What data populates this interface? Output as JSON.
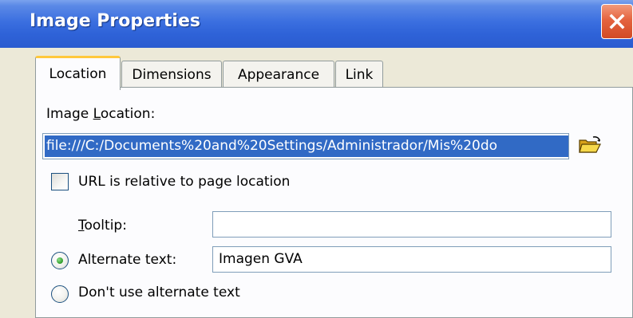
{
  "window": {
    "title": "Image Properties",
    "close_icon": "close-icon"
  },
  "tabs": [
    {
      "label": "Location",
      "active": true
    },
    {
      "label": "Dimensions",
      "active": false
    },
    {
      "label": "Appearance",
      "active": false
    },
    {
      "label": "Link",
      "active": false
    }
  ],
  "location": {
    "image_location_label_prefix": "Image ",
    "image_location_label_accel": "L",
    "image_location_label_suffix": "ocation:",
    "image_location_value": "file:///C:/Documents%20and%20Settings/Administrador/Mis%20do",
    "choose_file_icon": "open-folder-icon",
    "relative_url": {
      "label": "URL is relative to page location",
      "checked": false
    },
    "tooltip": {
      "label_accel": "T",
      "label_rest": "ooltip:",
      "value": ""
    },
    "alt_text": {
      "label": "Alternate text:",
      "selected": true,
      "value": "Imagen GVA"
    },
    "no_alt_text": {
      "label": "Don't use alternate text",
      "selected": false
    }
  },
  "colors": {
    "titlebar_blue": "#2f63d8",
    "close_red": "#e4633f",
    "selection_blue": "#316ac5",
    "dialog_bg": "#ece9d8",
    "tab_highlight": "#ffc83c"
  }
}
